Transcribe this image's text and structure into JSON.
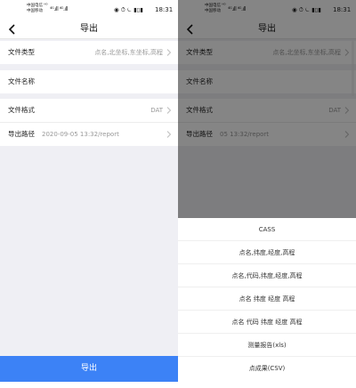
{
  "status_bar": {
    "carrier_line1": "中国电信 ᵸᴰ",
    "carrier_line2": "中国移动",
    "signal": "⁴ᴳ.ıll ⁴ᴳ.ıll",
    "icons": "◉ ⏱ ⏾ ▮▯▮",
    "time": "18:31"
  },
  "navbar": {
    "title": "导出"
  },
  "form": {
    "file_type": {
      "label": "文件类型",
      "value": "点名,北坐标,东坐标,高程"
    },
    "file_name": {
      "label": "文件名称",
      "value": ""
    },
    "file_format": {
      "label": "文件格式",
      "value": "DAT"
    },
    "export_path": {
      "label": "导出路径",
      "value": "2020-09-05 13:32/report",
      "value_right": "05 13:32/report"
    }
  },
  "export_button": {
    "label": "导出"
  },
  "format_sheet": {
    "options": [
      "CASS",
      "点名,纬度,经度,高程",
      "点名,代码,纬度,经度,高程",
      "点名 纬度 经度 高程",
      "点名 代码 纬度 经度 高程",
      "测量报告(xls)",
      "点成果(CSV)"
    ]
  },
  "colors": {
    "accent": "#3c82f6",
    "background": "#efeff4",
    "text_secondary": "#999999"
  }
}
